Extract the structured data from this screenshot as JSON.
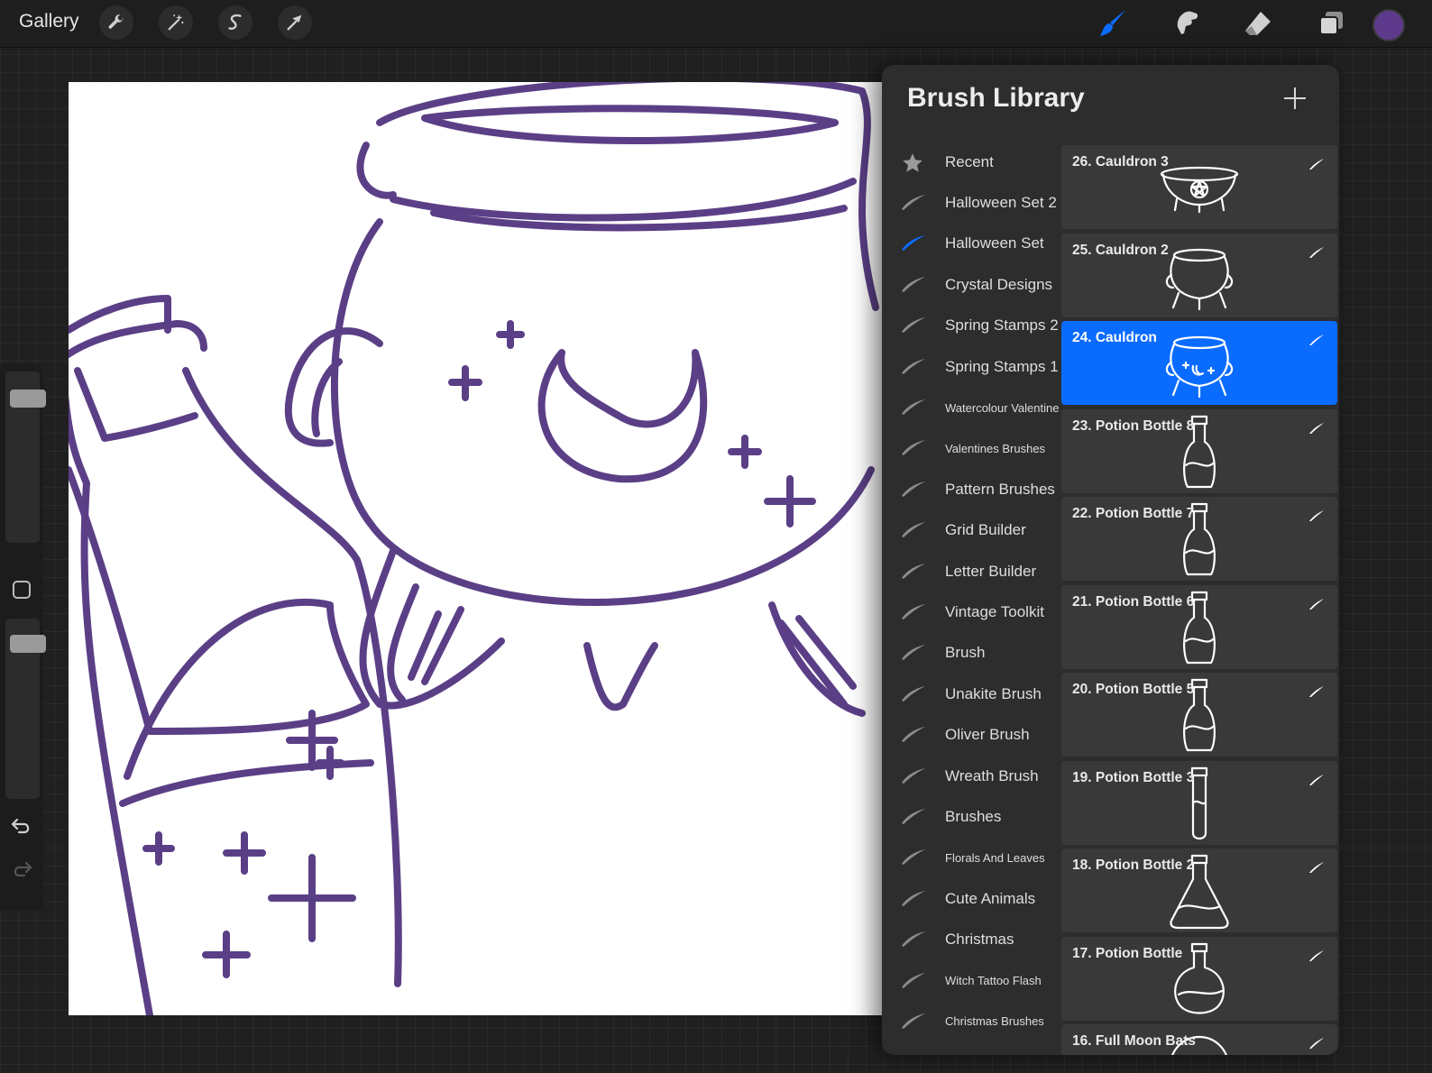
{
  "header": {
    "gallery_label": "Gallery",
    "left_tools": [
      "wrench-icon",
      "magic-wand-icon",
      "selection-s-icon",
      "transform-arrow-icon"
    ],
    "right_tools": [
      "brush-icon",
      "smudge-icon",
      "eraser-icon",
      "layers-icon"
    ],
    "active_tool": "brush-icon",
    "brush_color": "#5e3a8c",
    "accent_color": "#0a6cff"
  },
  "sidebar": {
    "size_level": 0.12,
    "opacity_level": 0.9
  },
  "brush_library": {
    "title": "Brush Library",
    "sets": [
      {
        "label": "Recent",
        "icon": "star-icon"
      },
      {
        "label": "Halloween Set 2",
        "icon": "brush-stroke-icon"
      },
      {
        "label": "Halloween Set",
        "icon": "brush-stroke-icon",
        "selected": true
      },
      {
        "label": "Crystal Designs",
        "icon": "brush-stroke-icon"
      },
      {
        "label": "Spring Stamps 2",
        "icon": "brush-stroke-icon"
      },
      {
        "label": "Spring Stamps 1",
        "icon": "brush-stroke-icon"
      },
      {
        "label": "Watercolour Valentines",
        "icon": "brush-stroke-icon",
        "small": true
      },
      {
        "label": "Valentines Brushes",
        "icon": "brush-stroke-icon",
        "small": true
      },
      {
        "label": "Pattern Brushes",
        "icon": "brush-stroke-icon"
      },
      {
        "label": "Grid Builder",
        "icon": "brush-stroke-icon"
      },
      {
        "label": "Letter Builder",
        "icon": "brush-stroke-icon"
      },
      {
        "label": "Vintage Toolkit",
        "icon": "brush-stroke-icon"
      },
      {
        "label": "Brush",
        "icon": "brush-stroke-icon"
      },
      {
        "label": "Unakite Brush",
        "icon": "brush-stroke-icon"
      },
      {
        "label": "Oliver Brush",
        "icon": "brush-stroke-icon"
      },
      {
        "label": "Wreath Brush",
        "icon": "brush-stroke-icon"
      },
      {
        "label": "Brushes",
        "icon": "brush-stroke-icon"
      },
      {
        "label": "Florals And Leaves",
        "icon": "brush-stroke-icon",
        "small": true
      },
      {
        "label": "Cute Animals",
        "icon": "brush-stroke-icon"
      },
      {
        "label": "Christmas",
        "icon": "brush-stroke-icon"
      },
      {
        "label": "Witch Tattoo Flash",
        "icon": "brush-stroke-icon",
        "small": true
      },
      {
        "label": "Christmas Brushes",
        "icon": "brush-stroke-icon",
        "small": true
      }
    ],
    "brushes": [
      {
        "name": "26. Cauldron 3",
        "preview": "cauldron-pentagram-stamp-icon"
      },
      {
        "name": "25. Cauldron 2",
        "preview": "cauldron-stamp-icon"
      },
      {
        "name": "24. Cauldron",
        "preview": "cauldron-moon-stamp-icon",
        "selected": true
      },
      {
        "name": "23. Potion Bottle 8",
        "preview": "potion-bottle-stamp-icon"
      },
      {
        "name": "22. Potion Bottle 7",
        "preview": "potion-bottle-stamp-icon"
      },
      {
        "name": "21. Potion Bottle 6",
        "preview": "potion-bottle-stamp-icon"
      },
      {
        "name": "20. Potion Bottle 5",
        "preview": "potion-bottle-stamp-icon"
      },
      {
        "name": "19. Potion Bottle 3",
        "preview": "test-tube-stamp-icon"
      },
      {
        "name": "18. Potion Bottle 2",
        "preview": "flask-stamp-icon"
      },
      {
        "name": "17. Potion Bottle",
        "preview": "round-potion-stamp-icon"
      },
      {
        "name": "16. Full Moon Bats",
        "preview": "moon-bats-stamp-icon"
      }
    ]
  }
}
